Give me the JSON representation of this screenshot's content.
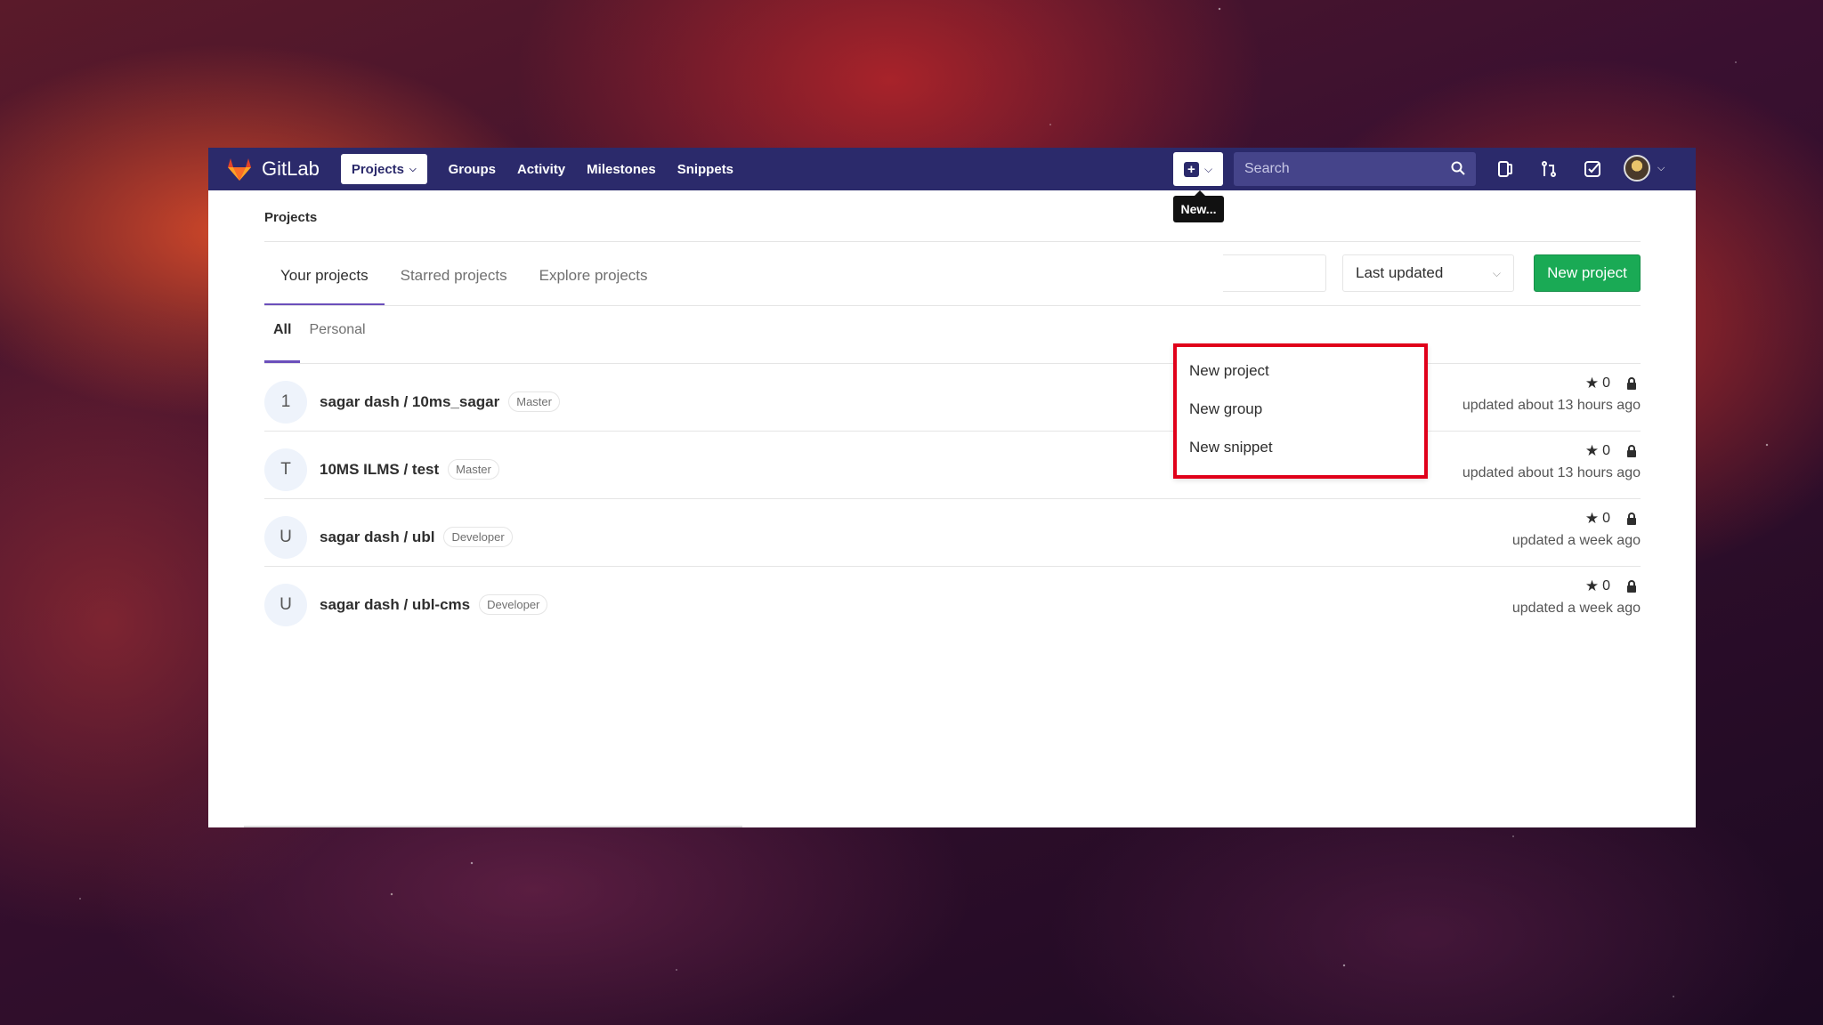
{
  "brand": {
    "name": "GitLab"
  },
  "nav": {
    "items": [
      {
        "label": "Projects"
      },
      {
        "label": "Groups"
      },
      {
        "label": "Activity"
      },
      {
        "label": "Milestones"
      },
      {
        "label": "Snippets"
      }
    ]
  },
  "header": {
    "search_placeholder": "Search",
    "new_tooltip": "New..."
  },
  "new_menu": {
    "items": [
      {
        "label": "New project"
      },
      {
        "label": "New group"
      },
      {
        "label": "New snippet"
      }
    ]
  },
  "breadcrumb": "Projects",
  "tabs": [
    {
      "label": "Your projects"
    },
    {
      "label": "Starred projects"
    },
    {
      "label": "Explore projects"
    }
  ],
  "filter": {
    "sort_value": "Last updated",
    "new_project_label": "New project"
  },
  "subtabs": [
    {
      "label": "All"
    },
    {
      "label": "Personal"
    }
  ],
  "projects": [
    {
      "avatar": "1",
      "name": "sagar dash / 10ms_sagar",
      "role": "Master",
      "stars": "0",
      "updated": "updated about 13 hours ago"
    },
    {
      "avatar": "T",
      "name": "10MS ILMS / test",
      "role": "Master",
      "stars": "0",
      "updated": "updated about 13 hours ago"
    },
    {
      "avatar": "U",
      "name": "sagar dash / ubl",
      "role": "Developer",
      "stars": "0",
      "updated": "updated a week ago"
    },
    {
      "avatar": "U",
      "name": "sagar dash / ubl-cms",
      "role": "Developer",
      "stars": "0",
      "updated": "updated a week ago"
    }
  ],
  "colors": {
    "navbar": "#2b2a6b",
    "accent": "#6b4fbb",
    "success": "#1aaa55",
    "highlight": "#e0001a"
  }
}
